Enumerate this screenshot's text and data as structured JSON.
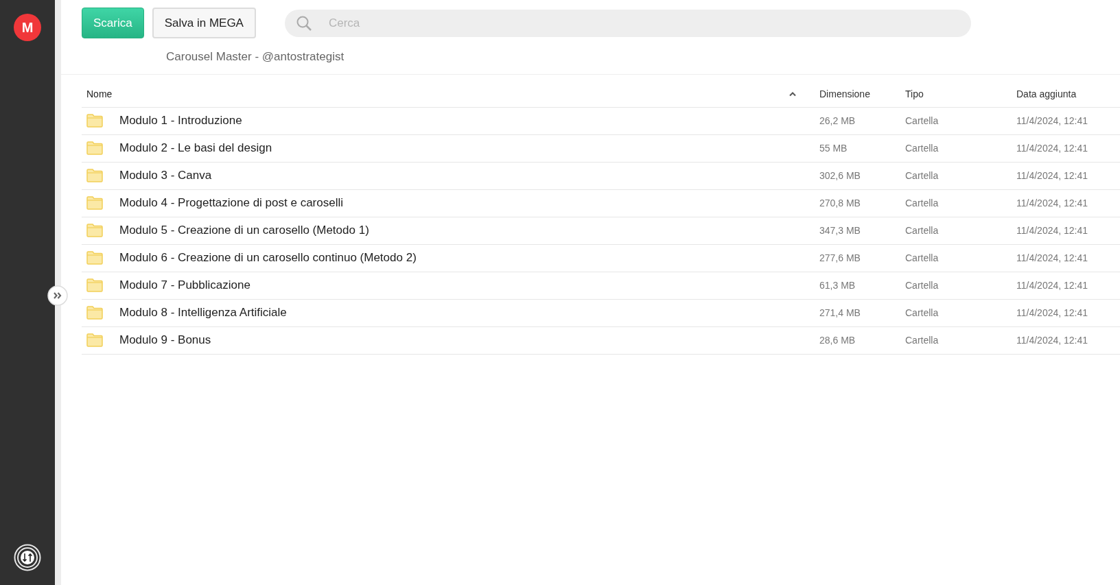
{
  "sidebar": {
    "logo_letter": "M"
  },
  "toolbar": {
    "buttons": [
      {
        "label": "Scarica",
        "kind": "primary"
      },
      {
        "label": "Salva in MEGA",
        "kind": "secondary"
      }
    ],
    "search": {
      "placeholder": "Cerca"
    }
  },
  "folder_title": "Carousel Master - @antostrategist",
  "table": {
    "columns": [
      {
        "label": "Nome",
        "sorted": true
      },
      {
        "label": "Dimensione",
        "sorted": false
      },
      {
        "label": "Tipo",
        "sorted": false
      },
      {
        "label": "Data aggiunta",
        "sorted": false
      }
    ],
    "rows": [
      {
        "name": "Modulo 1 - Introduzione",
        "size": "26,2 MB",
        "type": "Cartella",
        "date": "11/4/2024, 12:41"
      },
      {
        "name": "Modulo 2 - Le basi del design",
        "size": "55 MB",
        "type": "Cartella",
        "date": "11/4/2024, 12:41"
      },
      {
        "name": "Modulo 3 - Canva",
        "size": "302,6 MB",
        "type": "Cartella",
        "date": "11/4/2024, 12:41"
      },
      {
        "name": "Modulo 4 - Progettazione di post e caroselli",
        "size": "270,8 MB",
        "type": "Cartella",
        "date": "11/4/2024, 12:41"
      },
      {
        "name": "Modulo 5 - Creazione di un carosello (Metodo 1)",
        "size": "347,3 MB",
        "type": "Cartella",
        "date": "11/4/2024, 12:41"
      },
      {
        "name": "Modulo 6 - Creazione di un carosello continuo (Metodo 2)",
        "size": "277,6 MB",
        "type": "Cartella",
        "date": "11/4/2024, 12:41"
      },
      {
        "name": "Modulo 7 - Pubblicazione",
        "size": "61,3 MB",
        "type": "Cartella",
        "date": "11/4/2024, 12:41"
      },
      {
        "name": "Modulo 8 - Intelligenza Artificiale",
        "size": "271,4 MB",
        "type": "Cartella",
        "date": "11/4/2024, 12:41"
      },
      {
        "name": "Modulo 9 - Bonus",
        "size": "28,6 MB",
        "type": "Cartella",
        "date": "11/4/2024, 12:41"
      }
    ]
  }
}
